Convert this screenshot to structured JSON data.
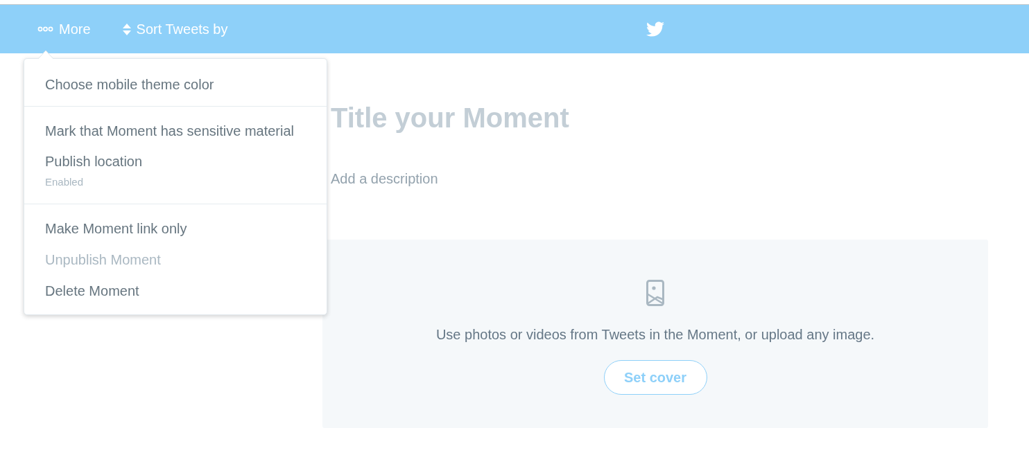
{
  "header": {
    "more_button": {
      "label": "More",
      "expanded": true
    },
    "sort_button": {
      "label": "Sort Tweets by"
    }
  },
  "menu": {
    "sections": [
      {
        "items": [
          {
            "label": "Choose mobile theme color",
            "disabled": false
          }
        ]
      },
      {
        "items": [
          {
            "label": "Mark that Moment has sensitive material",
            "disabled": false
          },
          {
            "label": "Publish location",
            "detail": "Enabled",
            "disabled": false
          }
        ]
      },
      {
        "items": [
          {
            "label": "Make Moment link only",
            "disabled": false
          },
          {
            "label": "Unpublish Moment",
            "disabled": true
          },
          {
            "label": "Delete Moment",
            "disabled": false
          }
        ]
      }
    ]
  },
  "editor": {
    "title_field": {
      "placeholder": "Title your Moment"
    },
    "description_field": {
      "placeholder": "Add a description"
    },
    "cover": {
      "hint": "Use photos or videos from Tweets in the Moment, or upload any image.",
      "button": "Set cover"
    }
  }
}
